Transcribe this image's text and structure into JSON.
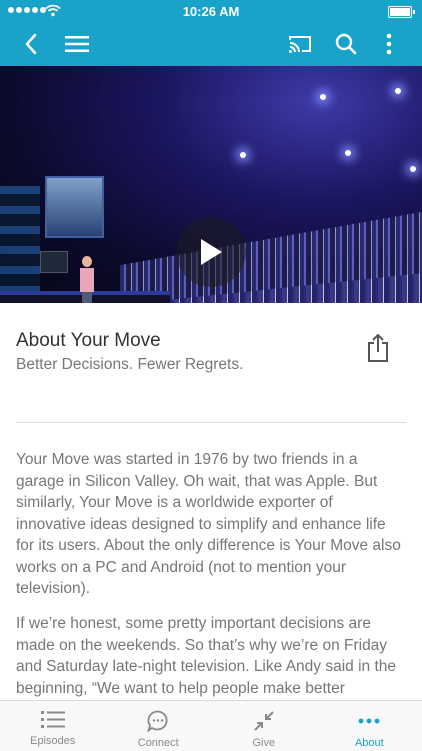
{
  "status": {
    "time": "10:26 AM"
  },
  "toolbar": {
    "back_icon": "chevron-left-icon",
    "menu_icon": "hamburger-icon",
    "cast_icon": "cast-icon",
    "search_icon": "search-icon",
    "more_icon": "vertical-dots-icon",
    "color": "#1aa3c9"
  },
  "hero": {
    "play_icon": "play-icon"
  },
  "about": {
    "title": "About Your Move",
    "subtitle": "Better Decisions. Fewer Regrets.",
    "share_icon": "share-icon",
    "paragraphs": [
      "Your Move was started in 1976 by two friends in a garage in Silicon Valley. Oh wait, that was Apple. But similarly, Your Move is a worldwide exporter of innovative ideas designed to simplify and enhance life for its users. About the only difference is Your Move also works on a PC and Android (not to mention your television).",
      "If we’re honest, some pretty important decisions are made on the weekends. So that’s why we’re on Friday and Saturday late-night television. Like Andy said in the beginning, “We want to help people make better"
    ]
  },
  "tabs": [
    {
      "label": "Episodes",
      "icon": "list-icon",
      "active": false
    },
    {
      "label": "Connect",
      "icon": "chat-bubble-icon",
      "active": false
    },
    {
      "label": "Give",
      "icon": "collapse-arrows-icon",
      "active": false
    },
    {
      "label": "About",
      "icon": "more-dots-icon",
      "active": true
    }
  ],
  "colors": {
    "accent": "#1aa3c9",
    "inactive": "#8a8a8a"
  }
}
